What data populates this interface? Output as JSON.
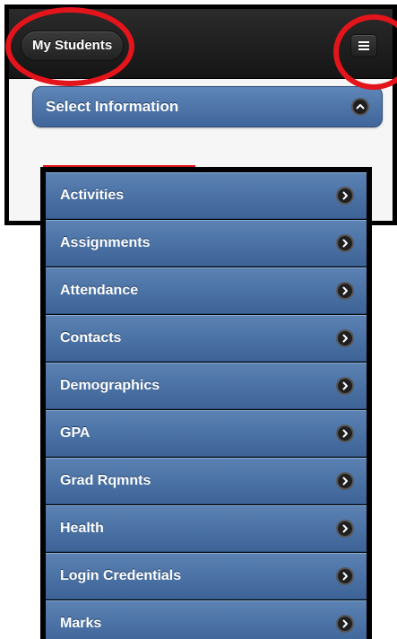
{
  "header": {
    "my_students_label": "My Students",
    "menu_icon": "hamburger-icon"
  },
  "select_information": {
    "label": "Select Information",
    "icon": "chevron-up-icon"
  },
  "menu_items": [
    {
      "label": "Activities",
      "icon": "chevron-right-icon"
    },
    {
      "label": "Assignments",
      "icon": "chevron-right-icon"
    },
    {
      "label": "Attendance",
      "icon": "chevron-right-icon"
    },
    {
      "label": "Contacts",
      "icon": "chevron-right-icon"
    },
    {
      "label": "Demographics",
      "icon": "chevron-right-icon"
    },
    {
      "label": "GPA",
      "icon": "chevron-right-icon"
    },
    {
      "label": "Grad Rqmnts",
      "icon": "chevron-right-icon"
    },
    {
      "label": "Health",
      "icon": "chevron-right-icon"
    },
    {
      "label": "Login Credentials",
      "icon": "chevron-right-icon"
    },
    {
      "label": "Marks",
      "icon": "chevron-right-icon"
    }
  ],
  "colors": {
    "header_bg": "#1c1c1c",
    "button_blue": "#4f76aa",
    "annotation_red": "#e4141b"
  }
}
